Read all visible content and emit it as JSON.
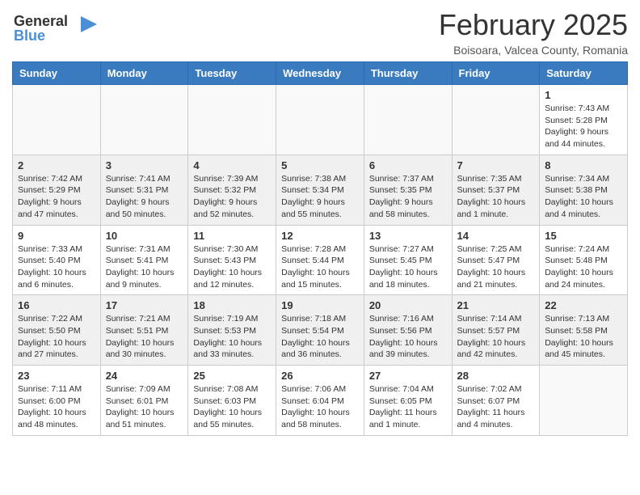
{
  "header": {
    "logo_line1": "General",
    "logo_line2": "Blue",
    "month_year": "February 2025",
    "location": "Boisoara, Valcea County, Romania"
  },
  "weekdays": [
    "Sunday",
    "Monday",
    "Tuesday",
    "Wednesday",
    "Thursday",
    "Friday",
    "Saturday"
  ],
  "weeks": [
    [
      {
        "day": "",
        "info": ""
      },
      {
        "day": "",
        "info": ""
      },
      {
        "day": "",
        "info": ""
      },
      {
        "day": "",
        "info": ""
      },
      {
        "day": "",
        "info": ""
      },
      {
        "day": "",
        "info": ""
      },
      {
        "day": "1",
        "info": "Sunrise: 7:43 AM\nSunset: 5:28 PM\nDaylight: 9 hours and 44 minutes."
      }
    ],
    [
      {
        "day": "2",
        "info": "Sunrise: 7:42 AM\nSunset: 5:29 PM\nDaylight: 9 hours and 47 minutes."
      },
      {
        "day": "3",
        "info": "Sunrise: 7:41 AM\nSunset: 5:31 PM\nDaylight: 9 hours and 50 minutes."
      },
      {
        "day": "4",
        "info": "Sunrise: 7:39 AM\nSunset: 5:32 PM\nDaylight: 9 hours and 52 minutes."
      },
      {
        "day": "5",
        "info": "Sunrise: 7:38 AM\nSunset: 5:34 PM\nDaylight: 9 hours and 55 minutes."
      },
      {
        "day": "6",
        "info": "Sunrise: 7:37 AM\nSunset: 5:35 PM\nDaylight: 9 hours and 58 minutes."
      },
      {
        "day": "7",
        "info": "Sunrise: 7:35 AM\nSunset: 5:37 PM\nDaylight: 10 hours and 1 minute."
      },
      {
        "day": "8",
        "info": "Sunrise: 7:34 AM\nSunset: 5:38 PM\nDaylight: 10 hours and 4 minutes."
      }
    ],
    [
      {
        "day": "9",
        "info": "Sunrise: 7:33 AM\nSunset: 5:40 PM\nDaylight: 10 hours and 6 minutes."
      },
      {
        "day": "10",
        "info": "Sunrise: 7:31 AM\nSunset: 5:41 PM\nDaylight: 10 hours and 9 minutes."
      },
      {
        "day": "11",
        "info": "Sunrise: 7:30 AM\nSunset: 5:43 PM\nDaylight: 10 hours and 12 minutes."
      },
      {
        "day": "12",
        "info": "Sunrise: 7:28 AM\nSunset: 5:44 PM\nDaylight: 10 hours and 15 minutes."
      },
      {
        "day": "13",
        "info": "Sunrise: 7:27 AM\nSunset: 5:45 PM\nDaylight: 10 hours and 18 minutes."
      },
      {
        "day": "14",
        "info": "Sunrise: 7:25 AM\nSunset: 5:47 PM\nDaylight: 10 hours and 21 minutes."
      },
      {
        "day": "15",
        "info": "Sunrise: 7:24 AM\nSunset: 5:48 PM\nDaylight: 10 hours and 24 minutes."
      }
    ],
    [
      {
        "day": "16",
        "info": "Sunrise: 7:22 AM\nSunset: 5:50 PM\nDaylight: 10 hours and 27 minutes."
      },
      {
        "day": "17",
        "info": "Sunrise: 7:21 AM\nSunset: 5:51 PM\nDaylight: 10 hours and 30 minutes."
      },
      {
        "day": "18",
        "info": "Sunrise: 7:19 AM\nSunset: 5:53 PM\nDaylight: 10 hours and 33 minutes."
      },
      {
        "day": "19",
        "info": "Sunrise: 7:18 AM\nSunset: 5:54 PM\nDaylight: 10 hours and 36 minutes."
      },
      {
        "day": "20",
        "info": "Sunrise: 7:16 AM\nSunset: 5:56 PM\nDaylight: 10 hours and 39 minutes."
      },
      {
        "day": "21",
        "info": "Sunrise: 7:14 AM\nSunset: 5:57 PM\nDaylight: 10 hours and 42 minutes."
      },
      {
        "day": "22",
        "info": "Sunrise: 7:13 AM\nSunset: 5:58 PM\nDaylight: 10 hours and 45 minutes."
      }
    ],
    [
      {
        "day": "23",
        "info": "Sunrise: 7:11 AM\nSunset: 6:00 PM\nDaylight: 10 hours and 48 minutes."
      },
      {
        "day": "24",
        "info": "Sunrise: 7:09 AM\nSunset: 6:01 PM\nDaylight: 10 hours and 51 minutes."
      },
      {
        "day": "25",
        "info": "Sunrise: 7:08 AM\nSunset: 6:03 PM\nDaylight: 10 hours and 55 minutes."
      },
      {
        "day": "26",
        "info": "Sunrise: 7:06 AM\nSunset: 6:04 PM\nDaylight: 10 hours and 58 minutes."
      },
      {
        "day": "27",
        "info": "Sunrise: 7:04 AM\nSunset: 6:05 PM\nDaylight: 11 hours and 1 minute."
      },
      {
        "day": "28",
        "info": "Sunrise: 7:02 AM\nSunset: 6:07 PM\nDaylight: 11 hours and 4 minutes."
      },
      {
        "day": "",
        "info": ""
      }
    ]
  ]
}
